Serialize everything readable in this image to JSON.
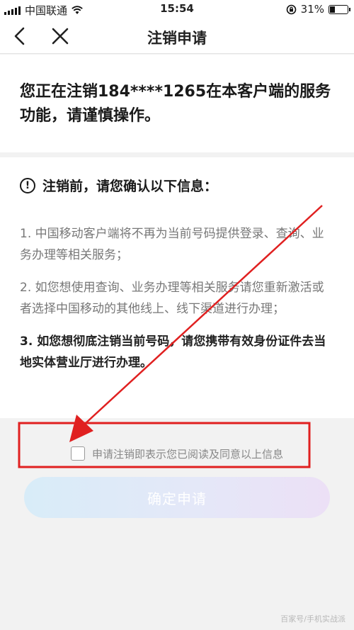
{
  "status_bar": {
    "carrier": "中国联通",
    "time": "15:54",
    "battery_percent": "31%",
    "battery_level": 0.31
  },
  "nav": {
    "title": "注销申请"
  },
  "intro": {
    "text": "您正在注销184****1265在本客户端的服务功能，请谨慎操作。"
  },
  "notice": {
    "heading": "注销前，请您确认以下信息：",
    "items": [
      "1. 中国移动客户端将不再为当前号码提供登录、查询、业务办理等相关服务；",
      "2. 如您想使用查询、业务办理等相关服务请您重新激活或者选择中国移动的其他线上、线下渠道进行办理；",
      "3. 如您想彻底注销当前号码，请您携带有效身份证件去当地实体营业厅进行办理。"
    ]
  },
  "agreement": {
    "label": "申请注销即表示您已阅读及同意以上信息",
    "checked": false
  },
  "confirm_button": {
    "label": "确定申请"
  },
  "watermark": "百家号/手机实战派",
  "colors": {
    "annotation_red": "#e02020",
    "button_gradient_start": "#d8ecf8",
    "button_gradient_end": "#ece0f6"
  },
  "icons": {
    "back": "chevron-left-icon",
    "close": "close-icon",
    "warning": "exclamation-circle-icon",
    "wifi": "wifi-icon",
    "orientation_lock": "orientation-lock-icon",
    "battery": "battery-icon"
  }
}
